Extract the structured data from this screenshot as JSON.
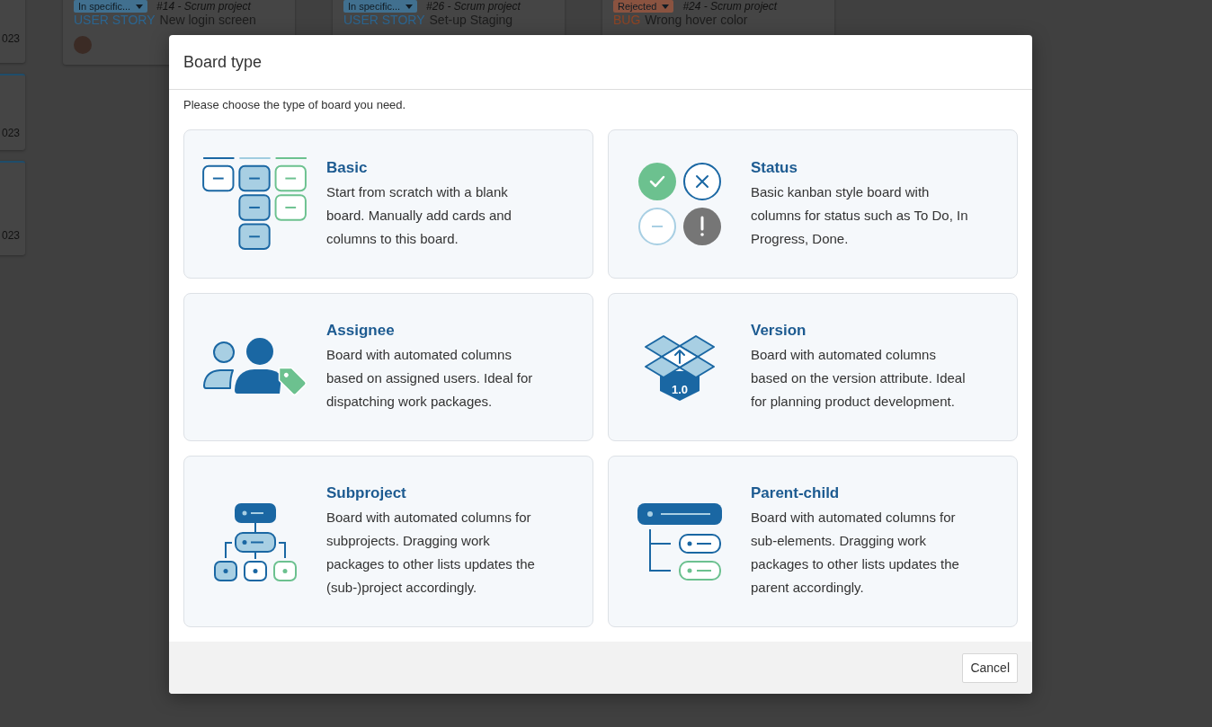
{
  "board": {
    "columns": [
      {
        "cards": [
          {
            "date": "023"
          },
          {
            "date": "023",
            "highlighted": true
          },
          {
            "date": "023",
            "highlighted": true
          }
        ]
      },
      {
        "cards": [
          {
            "status": {
              "label": "In specific...",
              "color": "#41708f"
            },
            "reference": "#14 - Scrum project",
            "type": {
              "label": "USER STORY",
              "color": "#2b6590"
            },
            "title": "New login screen",
            "avatar": true
          }
        ]
      },
      {
        "cards": [
          {
            "status": {
              "label": "In specific...",
              "color": "#41708f"
            },
            "reference": "#26 - Scrum project",
            "type": {
              "label": "USER STORY",
              "color": "#2b6590"
            },
            "title": "Set-up Staging"
          }
        ]
      },
      {
        "cards": [
          {
            "status": {
              "label": "Rejected",
              "color": "#8a5340"
            },
            "reference": "#24 - Scrum project",
            "type": {
              "label": "BUG",
              "color": "#8e4424"
            },
            "title": "Wrong hover color"
          }
        ]
      }
    ]
  },
  "dialog": {
    "title": "Board type",
    "intro": "Please choose the type of board you need.",
    "options": [
      {
        "kind": "basic",
        "title": "Basic",
        "description": "Start from scratch with a blank board. Manually add cards and columns to this board."
      },
      {
        "kind": "status",
        "title": "Status",
        "description": "Basic kanban style board with columns for status such as To Do, In Progress, Done."
      },
      {
        "kind": "assignee",
        "title": "Assignee",
        "description": "Board with automated columns based on assigned users. Ideal for dispatching work packages."
      },
      {
        "kind": "version",
        "title": "Version",
        "icon_label": "1.0",
        "description": "Board with automated columns based on the version attribute. Ideal for planning product development."
      },
      {
        "kind": "subproject",
        "title": "Subproject",
        "description": "Board with automated columns for subprojects. Dragging work packages to other lists updates the (sub-)project accordingly."
      },
      {
        "kind": "parent_child",
        "title": "Parent-child",
        "description": "Board with automated columns for sub-elements. Dragging work packages to other lists updates the parent accordingly."
      }
    ],
    "buttons": [
      {
        "label": "Cancel"
      }
    ]
  }
}
